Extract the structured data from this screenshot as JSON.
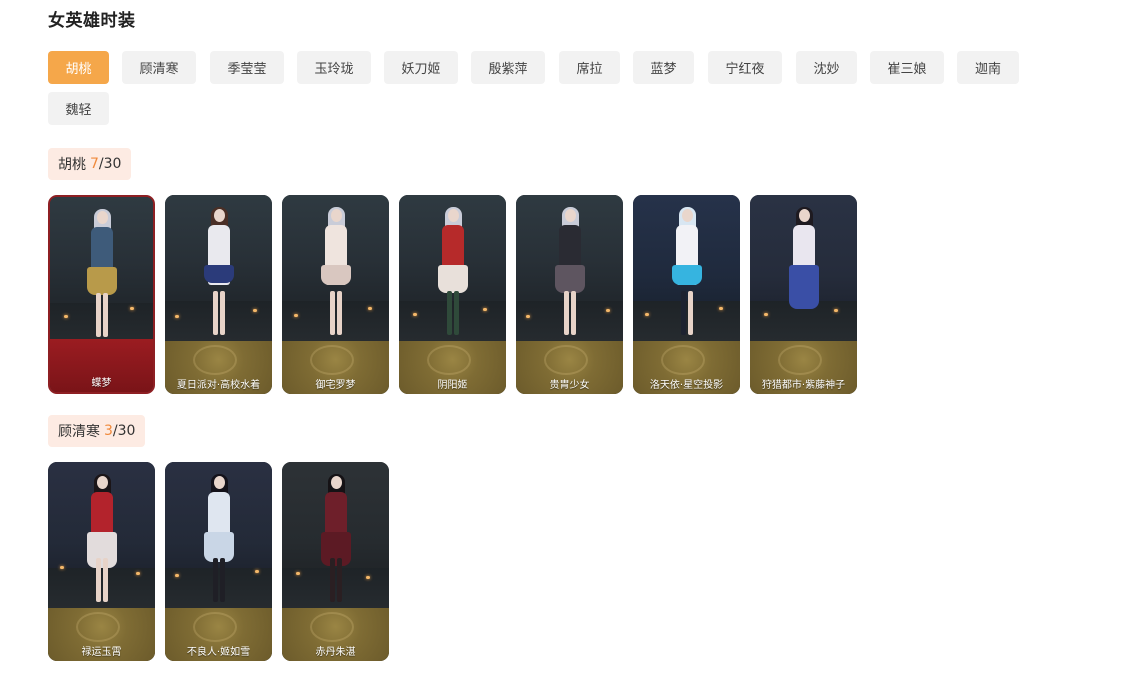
{
  "page": {
    "title": "女英雄时装"
  },
  "tabs": [
    {
      "label": "胡桃",
      "active": true
    },
    {
      "label": "顾清寒",
      "active": false
    },
    {
      "label": "季莹莹",
      "active": false
    },
    {
      "label": "玉玲珑",
      "active": false
    },
    {
      "label": "妖刀姬",
      "active": false
    },
    {
      "label": "殷紫萍",
      "active": false
    },
    {
      "label": "席拉",
      "active": false
    },
    {
      "label": "蓝梦",
      "active": false
    },
    {
      "label": "宁红夜",
      "active": false
    },
    {
      "label": "沈妙",
      "active": false
    },
    {
      "label": "崔三娘",
      "active": false
    },
    {
      "label": "迦南",
      "active": false
    },
    {
      "label": "魏轻",
      "active": false
    }
  ],
  "sections": [
    {
      "hero": "胡桃",
      "owned": "7",
      "total_text": "/30",
      "skins": [
        {
          "name": "蝶梦",
          "selected": true
        },
        {
          "name": "夏日派对·高校水着",
          "selected": false
        },
        {
          "name": "御宅罗梦",
          "selected": false
        },
        {
          "name": "阴阳姬",
          "selected": false
        },
        {
          "name": "贵胄少女",
          "selected": false
        },
        {
          "name": "洛天依·星空投影",
          "selected": false
        },
        {
          "name": "狩猎都市·紫藤神子",
          "selected": false
        }
      ]
    },
    {
      "hero": "顾清寒",
      "owned": "3",
      "total_text": "/30",
      "skins": [
        {
          "name": "禄运玉霄",
          "selected": false
        },
        {
          "name": "不良人·姬如雪",
          "selected": false
        },
        {
          "name": "赤丹朱湛",
          "selected": false
        }
      ]
    }
  ],
  "colors": {
    "accent": "#f5a74a",
    "count": "#f08a3c",
    "tag_bg": "#fdebe3",
    "selected_border": "#8e1f23",
    "plate_gold": "#7f6c34"
  }
}
